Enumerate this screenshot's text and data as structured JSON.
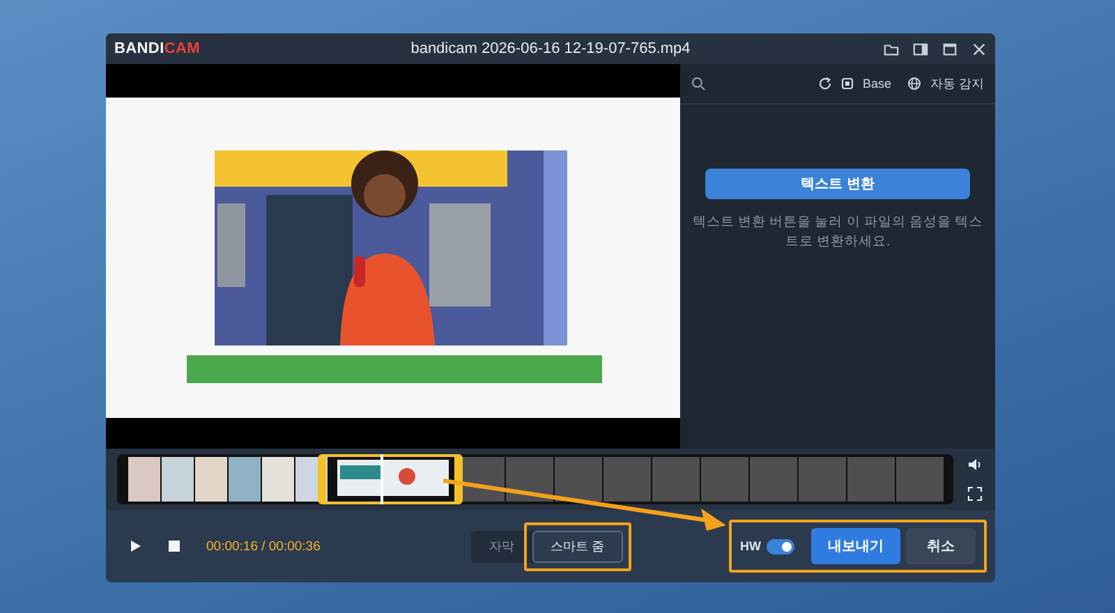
{
  "window": {
    "logo": [
      "BANDI",
      "CAM"
    ],
    "title": "bandicam 2026-06-16 12-19-07-765.mp4"
  },
  "side_panel": {
    "model": "Base",
    "language": "자동 감지",
    "convert_button": "텍스트 변환",
    "hint": "텍스트 변환 버튼을 눌러 이 파일의 음성을 텍스트로 변환하세요."
  },
  "player": {
    "time": "00:00:16 / 00:00:36"
  },
  "modes": [
    {
      "label": "자막",
      "selected": false
    },
    {
      "label": "스마트 줌",
      "selected": true
    }
  ],
  "hw": {
    "label": "HW",
    "on": true
  },
  "buttons": [
    {
      "label": "내보내기",
      "kind": "primary"
    },
    {
      "label": "취소",
      "kind": "secondary"
    }
  ]
}
